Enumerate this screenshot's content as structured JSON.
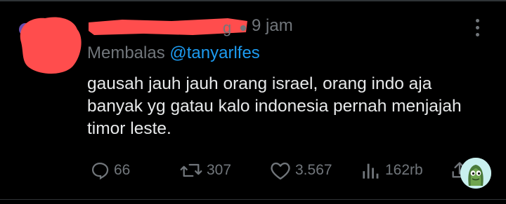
{
  "tweet": {
    "time": "9 jam",
    "handle_tail": "g",
    "reply_prefix": "Membalas",
    "reply_mention": "@tanyarlfes",
    "lines": [
      "gausah jauh jauh orang israel, orang indo aja",
      "banyak yg gatau kalo indonesia pernah menjajah",
      "timor leste."
    ]
  },
  "actions": {
    "reply_count": "66",
    "retweet_count": "307",
    "like_count": "3.567",
    "view_count": "162rb"
  },
  "icons": {
    "reply": "reply-icon",
    "retweet": "retweet-icon",
    "like": "heart-icon",
    "views": "views-icon",
    "share": "share-icon",
    "more": "more-icon"
  },
  "colors": {
    "background": "#000000",
    "text": "#e7e9ea",
    "muted": "#71767b",
    "mention": "#1d9bf0",
    "redaction": "#ff4d4d"
  }
}
